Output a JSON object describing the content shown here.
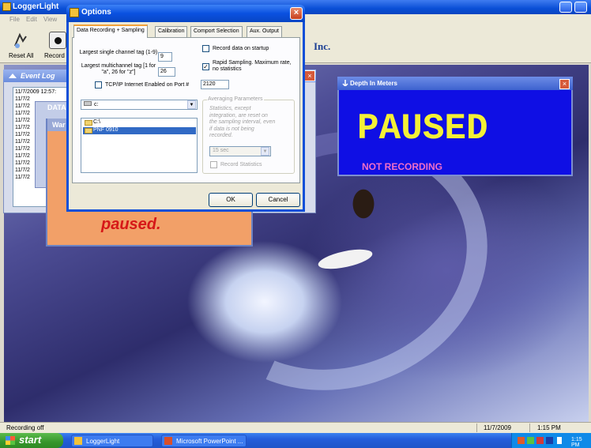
{
  "main_window": {
    "title": "LoggerLight",
    "menu": [
      "File",
      "Edit",
      "View"
    ],
    "toolbar": {
      "reset_all": "Reset All",
      "record": "Record"
    },
    "company_suffix": "Inc."
  },
  "event_log": {
    "title": "Event Log",
    "lines": [
      "11/7/2009 12:57:",
      "11/7/2",
      "11/7/2",
      "11/7/2",
      "11/7/2",
      "11/7/2",
      "11/7/2",
      "11/7/2",
      "11/7/2",
      "11/7/2",
      "11/7/2",
      "11/7/2",
      "11/7/2"
    ]
  },
  "data_window": {
    "title": "DATA"
  },
  "warning_window": {
    "title": "War",
    "message": "paused."
  },
  "options": {
    "title": "Options",
    "tabs": [
      "Data Recording + Sampling",
      "Calibration",
      "Comport Selection",
      "Aux. Output"
    ],
    "largest_single_label": "Largest single channel tag (1-9)",
    "largest_single_value": "9",
    "largest_multi_label": "Largest multichannel tag [1 for \"a\", 26 for \"z\"]",
    "largest_multi_value": "26",
    "tcp_label": "TCP/IP Internet Enabled on Port #",
    "tcp_port": "2120",
    "record_on_startup": "Record data on startup",
    "rapid_sampling": "Rapid Sampling. Maximum rate, no statistics",
    "drive": "c:",
    "folders": [
      "C:\\",
      "PNF 0910"
    ],
    "averaging_title": "Averaging Parameters",
    "averaging_note": "Statistics, except integration, are reset on the sampling interval, even if data is not being recorded.",
    "interval": "15 sec",
    "record_statistics": "Record Statistics",
    "ok": "OK",
    "cancel": "Cancel"
  },
  "depth_window": {
    "title": "Depth In Meters",
    "state": "PAUSED",
    "status": "NOT RECORDING"
  },
  "statusbar": {
    "left": "Recording off",
    "date": "11/7/2009",
    "time": "1:15 PM"
  },
  "taskbar": {
    "start": "start",
    "items": [
      "LoggerLight",
      "Microsoft PowerPoint ..."
    ],
    "clock": "1:15 PM"
  },
  "colors": {
    "depth_bg": "#0f0fe4",
    "paused_text": "#f4f036",
    "not_recording": "#f06ec8",
    "warning_bg": "#f2a068"
  }
}
